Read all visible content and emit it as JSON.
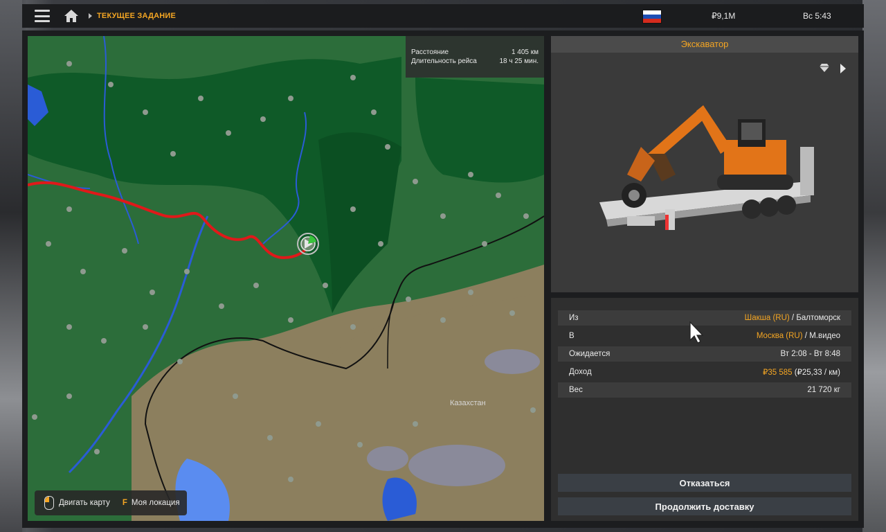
{
  "topbar": {
    "breadcrumb": "ТЕКУЩЕЕ ЗАДАНИЕ",
    "money": "₽9,1M",
    "clock": "Вс 5:43",
    "flag_colors": [
      "#ffffff",
      "#1e4fb5",
      "#d52b1e"
    ]
  },
  "trip": {
    "distance_label": "Расстояние",
    "distance_value": "1 405 км",
    "duration_label": "Длительность рейса",
    "duration_value": "18 ч 25 мин."
  },
  "map": {
    "country_label": "Казахстан",
    "legend_move": "Двигать карту",
    "legend_key": "F",
    "legend_location": "Моя локация",
    "route_color": "#e0191a",
    "land_green": "#2c6d3a",
    "forest_green": "#0f5a28",
    "steppe": "#8c7f5e",
    "water": "#2a5cd6"
  },
  "cargo": {
    "title": "Экскаватор"
  },
  "details": {
    "from_label": "Из",
    "from_company": "Шакша (RU)",
    "from_city": "Балтоморск",
    "to_label": "В",
    "to_company": "Москва (RU)",
    "to_city": "М.видео",
    "expected_label": "Ожидается",
    "expected_value": "Вт 2:08 - Вт 8:48",
    "income_label": "Доход",
    "income_value": "₽35 585",
    "income_rate": "(₽25,33 / км)",
    "weight_label": "Вес",
    "weight_value": "21 720 кг",
    "separator": "/"
  },
  "actions": {
    "cancel": "Отказаться",
    "continue": "Продолжить доставку"
  }
}
